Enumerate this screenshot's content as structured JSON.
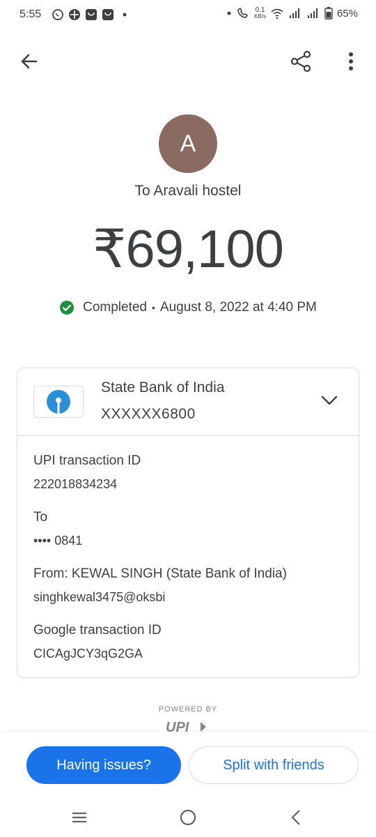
{
  "status_bar": {
    "time": "5:55",
    "net_speed_value": "0.1",
    "net_speed_unit": "KB/s",
    "battery": "65%"
  },
  "payment": {
    "avatar_letter": "A",
    "recipient": "To Aravali hostel",
    "amount": "₹69,100",
    "status": "Completed",
    "separator": "•",
    "datetime": "August 8, 2022 at 4:40 PM"
  },
  "bank": {
    "name": "State Bank of India",
    "account": "XXXXXX6800"
  },
  "details": {
    "upi_label": "UPI transaction ID",
    "upi_value": "222018834234",
    "to_label": "To",
    "to_value": "•••• 0841",
    "from_label": "From: KEWAL  SINGH (State Bank of India)",
    "from_value": "singhkewal3475@oksbi",
    "google_label": "Google transaction ID",
    "google_value": "CICAgJCY3qG2GA"
  },
  "footer": {
    "powered_by": "POWERED BY",
    "upi_logo_text": "UPI"
  },
  "actions": {
    "issues": "Having issues?",
    "split": "Split with friends"
  },
  "colors": {
    "accent": "#1a73e8",
    "avatar_bg": "#8a6b61",
    "success": "#1e8e3e"
  }
}
